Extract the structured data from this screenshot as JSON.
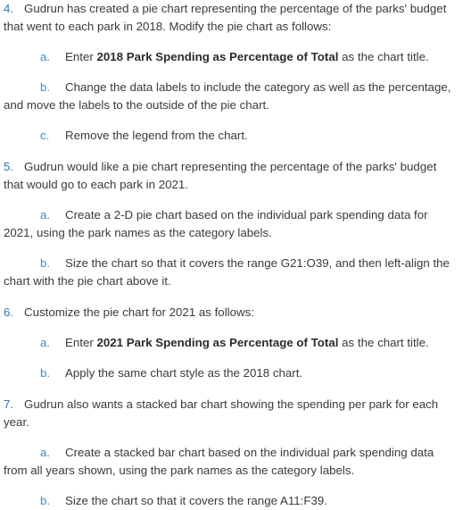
{
  "document": {
    "type": "instruction-list",
    "accent_number_color": "#2e74b5",
    "accent_letter_color": "#2f8fd8",
    "body_text_color": "#3a3a3a",
    "background_color": "#ffffff",
    "steps": [
      {
        "number": "4.",
        "text": "Gudrun has created a pie chart representing the percentage of the parks' budget that went to each park in 2018. Modify the pie chart as follows:",
        "substeps": [
          {
            "letter": "a.",
            "text_before": "Enter ",
            "bold": "2018 Park Spending as Percentage of Total",
            "text_after": " as the chart title."
          },
          {
            "letter": "b.",
            "text_before": "Change the data labels to include the category as well as the percentage, and move the labels to the outside of the pie chart.",
            "bold": "",
            "text_after": ""
          },
          {
            "letter": "c.",
            "text_before": "Remove the legend from the chart.",
            "bold": "",
            "text_after": ""
          }
        ]
      },
      {
        "number": "5.",
        "text": "Gudrun would like a pie chart representing the percentage of the parks' budget that would go to each park in 2021.",
        "substeps": [
          {
            "letter": "a.",
            "text_before": "Create a 2-D pie chart based on the individual park spending data for 2021, using the park names as the category labels.",
            "bold": "",
            "text_after": ""
          },
          {
            "letter": "b.",
            "text_before": "Size the chart so that it covers the range G21:O39, and then left-align the chart with the pie chart above it.",
            "bold": "",
            "text_after": ""
          }
        ]
      },
      {
        "number": "6.",
        "text": "Customize the pie chart for 2021 as follows:",
        "substeps": [
          {
            "letter": "a.",
            "text_before": "Enter ",
            "bold": "2021 Park Spending as Percentage of Total",
            "text_after": " as the chart title."
          },
          {
            "letter": "b.",
            "text_before": "Apply the same chart style as the 2018 chart.",
            "bold": "",
            "text_after": ""
          }
        ]
      },
      {
        "number": "7.",
        "text": "Gudrun also wants a stacked bar chart showing the spending per park for each year.",
        "substeps": [
          {
            "letter": "a.",
            "text_before": "Create a stacked bar chart based on the individual park spending data from all years shown, using the park names as the category labels.",
            "bold": "",
            "text_after": ""
          },
          {
            "letter": "b.",
            "text_before": "Size the chart so that it covers the range A11:F39.",
            "bold": "",
            "text_after": ""
          }
        ]
      }
    ]
  }
}
